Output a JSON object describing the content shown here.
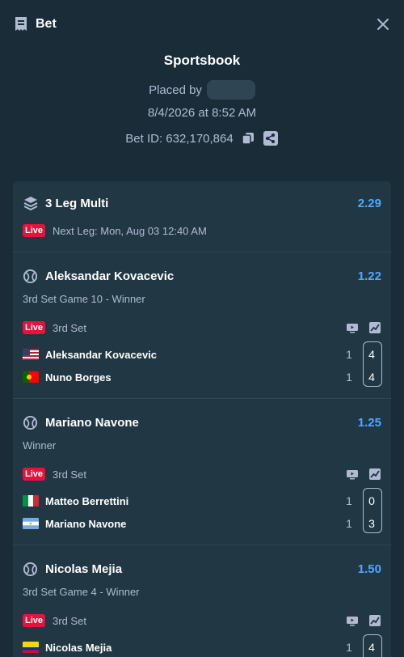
{
  "header": {
    "title": "Bet"
  },
  "summary": {
    "title": "Sportsbook",
    "placed_by_label": "Placed by",
    "date": "8/4/2026 at 8:52 AM",
    "bet_id": "Bet ID: 632,170,864"
  },
  "multi": {
    "title": "3 Leg Multi",
    "odds": "2.29",
    "live_label": "Live",
    "next_leg": "Next Leg: Mon, Aug 03 12:40 AM"
  },
  "legs": [
    {
      "selection": "Aleksandar Kovacevic",
      "odds": "1.22",
      "market": "3rd Set Game 10 - Winner",
      "live_label": "Live",
      "status": "3rd Set",
      "teams": [
        {
          "name": "Aleksandar Kovacevic",
          "flag": "us",
          "sets": "1",
          "current": "4"
        },
        {
          "name": "Nuno Borges",
          "flag": "pt",
          "sets": "1",
          "current": "4"
        }
      ]
    },
    {
      "selection": "Mariano Navone",
      "odds": "1.25",
      "market": "Winner",
      "live_label": "Live",
      "status": "3rd Set",
      "teams": [
        {
          "name": "Matteo Berrettini",
          "flag": "it",
          "sets": "1",
          "current": "0"
        },
        {
          "name": "Mariano Navone",
          "flag": "ar",
          "sets": "1",
          "current": "3"
        }
      ]
    },
    {
      "selection": "Nicolas Mejia",
      "odds": "1.50",
      "market": "3rd Set Game 4 - Winner",
      "live_label": "Live",
      "status": "3rd Set",
      "teams": [
        {
          "name": "Nicolas Mejia",
          "flag": "co",
          "sets": "1",
          "current": "4"
        }
      ]
    }
  ],
  "colors": {
    "background": "#1a2c38",
    "card": "#213743",
    "odds": "#4fa8ff",
    "live": "#e9113c"
  }
}
